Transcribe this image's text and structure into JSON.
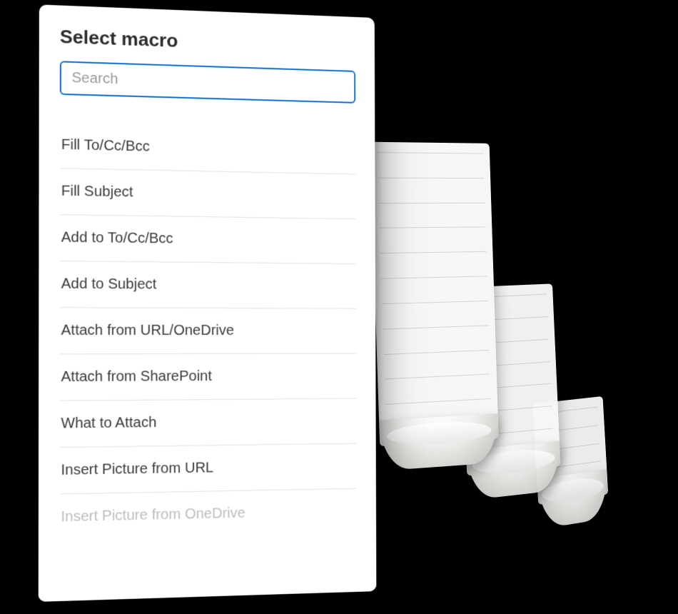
{
  "panel": {
    "title": "Select macro",
    "search": {
      "placeholder": "Search",
      "value": ""
    }
  },
  "macros": [
    {
      "label": "Fill To/Cc/Bcc"
    },
    {
      "label": "Fill Subject"
    },
    {
      "label": "Add to To/Cc/Bcc"
    },
    {
      "label": "Add to Subject"
    },
    {
      "label": "Attach from URL/OneDrive"
    },
    {
      "label": "Attach from SharePoint"
    },
    {
      "label": "What to Attach"
    },
    {
      "label": "Insert Picture from URL"
    },
    {
      "label": "Insert Picture from OneDrive"
    }
  ]
}
